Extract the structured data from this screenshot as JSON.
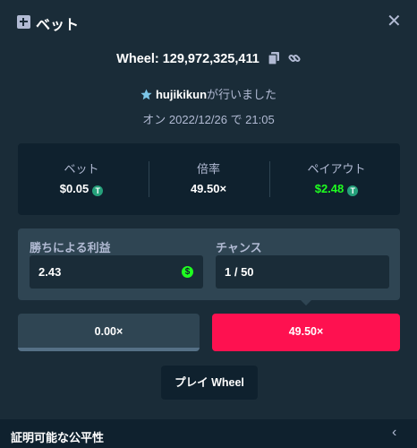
{
  "modal": {
    "title": "ベット",
    "close_glyph": "✕"
  },
  "bet_info": {
    "wheel_label": "Wheel: 129,972,325,411",
    "username": "hujikikun",
    "by_suffix": "が行いました",
    "date_line": "オン 2022/12/26 で 21:05"
  },
  "stats": {
    "bet_label": "ベット",
    "bet_value": "$0.05",
    "multiplier_label": "倍率",
    "multiplier_value": "49.50×",
    "payout_label": "ペイアウト",
    "payout_value": "$2.48",
    "currency_glyph": "T"
  },
  "calculator": {
    "profit_label": "勝ちによる利益",
    "profit_value": "2.43",
    "dollar_glyph": "$",
    "chance_label": "チャンス",
    "chance_value": "1 / 50"
  },
  "segments": {
    "low_label": "0.00×",
    "high_label": "49.50×"
  },
  "play_button_label": "プレイ Wheel",
  "provably_fair": {
    "label": "証明可能な公平性",
    "chevron": "‹"
  },
  "colors": {
    "background": "#1a2c38",
    "panel": "#0f212e",
    "accent_red": "#fe1150",
    "win_green": "#1fff20",
    "tether": "#26a17b"
  },
  "icons": [
    "bet-slip-icon",
    "close-icon",
    "copy-icon",
    "link-icon",
    "vip-star-icon",
    "tether-icon",
    "dollar-coin-icon",
    "chevron-left-icon"
  ]
}
